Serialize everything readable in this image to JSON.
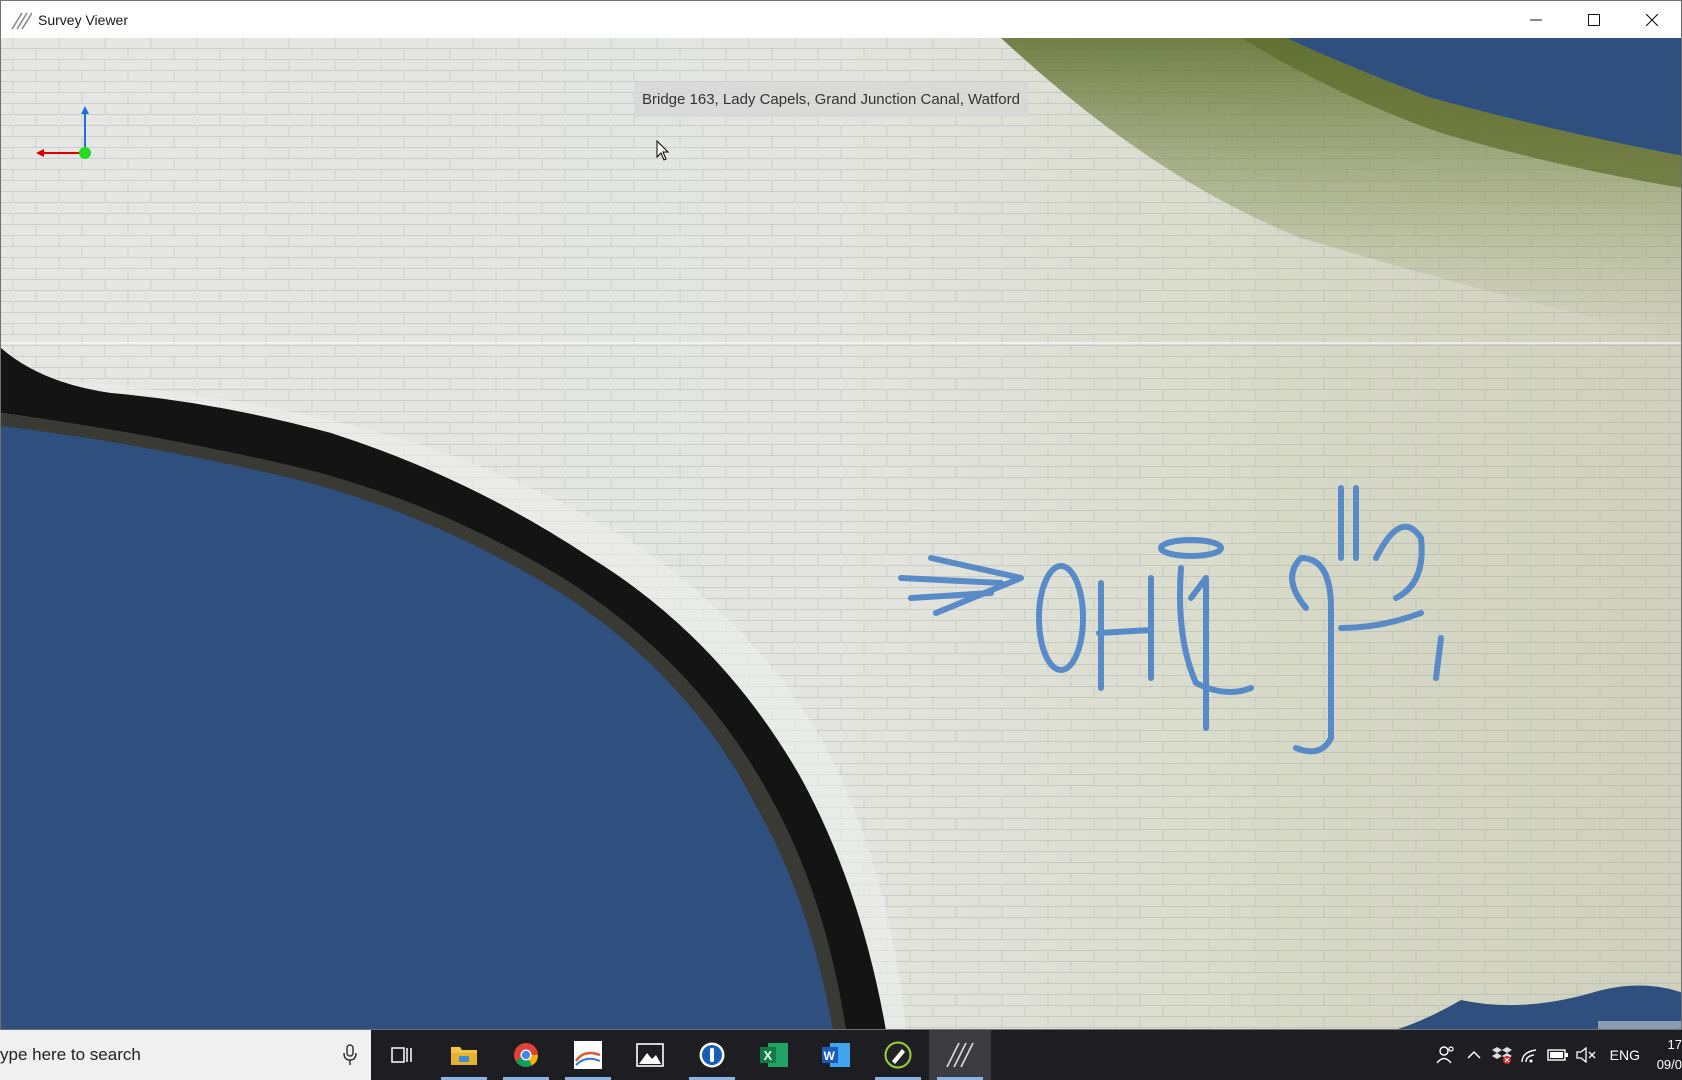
{
  "window": {
    "title": "Survey Viewer",
    "controls": {
      "minimize": "minimize",
      "maximize": "maximize",
      "close": "close"
    }
  },
  "viewer": {
    "info_label": "Bridge 163, Lady Capels, Grand Junction Canal, Watford",
    "axis_colors": {
      "x": "#e00000",
      "y": "#1e6fe0",
      "origin": "#22dd22"
    },
    "graffiti_text": "OHLIG",
    "sky_color": "#2f4f7e"
  },
  "taskbar": {
    "search_placeholder": "ype here to search",
    "apps": [
      {
        "name": "task-view-icon"
      },
      {
        "name": "file-explorer-icon"
      },
      {
        "name": "chrome-icon"
      },
      {
        "name": "mapping-app-icon"
      },
      {
        "name": "photos-icon"
      },
      {
        "name": "password-manager-icon"
      },
      {
        "name": "excel-icon"
      },
      {
        "name": "word-icon"
      },
      {
        "name": "pen-app-icon"
      },
      {
        "name": "survey-viewer-icon"
      }
    ],
    "tray": {
      "language": "ENG",
      "time": "17",
      "date": "09/0"
    }
  }
}
